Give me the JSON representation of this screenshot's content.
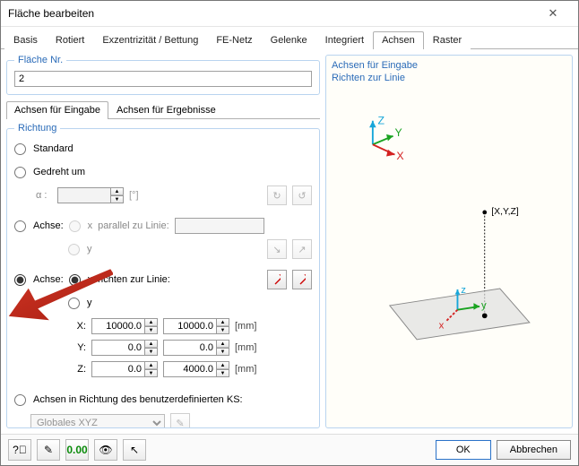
{
  "window": {
    "title": "Fläche bearbeiten"
  },
  "tabs": [
    {
      "label": "Basis"
    },
    {
      "label": "Rotiert"
    },
    {
      "label": "Exzentrizität / Bettung"
    },
    {
      "label": "FE-Netz"
    },
    {
      "label": "Gelenke"
    },
    {
      "label": "Integriert"
    },
    {
      "label": "Achsen",
      "active": true
    },
    {
      "label": "Raster"
    }
  ],
  "surface_no": {
    "legend": "Fläche Nr.",
    "value": "2"
  },
  "subtabs": [
    {
      "label": "Achsen für Eingabe",
      "active": true
    },
    {
      "label": "Achsen für Ergebnisse"
    }
  ],
  "direction": {
    "legend": "Richtung",
    "standard": "Standard",
    "rotated": "Gedreht um",
    "rotated_symbol": "α :",
    "rotated_unit": "[°]",
    "axis_parallel": "Achse:",
    "parallel_text": "parallel zu Linie:",
    "axis_align": "Achse:",
    "align_text": "richten zur Linie:",
    "x": "x",
    "y": "y",
    "X": "X:",
    "Y": "Y:",
    "Z": "Z:",
    "xyz": {
      "x1": "10000.0",
      "x2": "10000.0",
      "y1": "0.0",
      "y2": "0.0",
      "z1": "0.0",
      "z2": "4000.0",
      "unit": "[mm]"
    },
    "user_cs": "Achsen in Richtung des benutzerdefinierten KS:",
    "cs_value": "Globales XYZ"
  },
  "preview": {
    "title1": "Achsen für Eingabe",
    "title2": "Richten zur Linie",
    "point_label": "[X,Y,Z]",
    "axis_z": "z",
    "axis_y": "y",
    "axis_x": "x",
    "big_x": "X",
    "big_y": "Y",
    "big_z": "Z"
  },
  "footer": {
    "ok": "OK",
    "cancel": "Abbrechen"
  }
}
